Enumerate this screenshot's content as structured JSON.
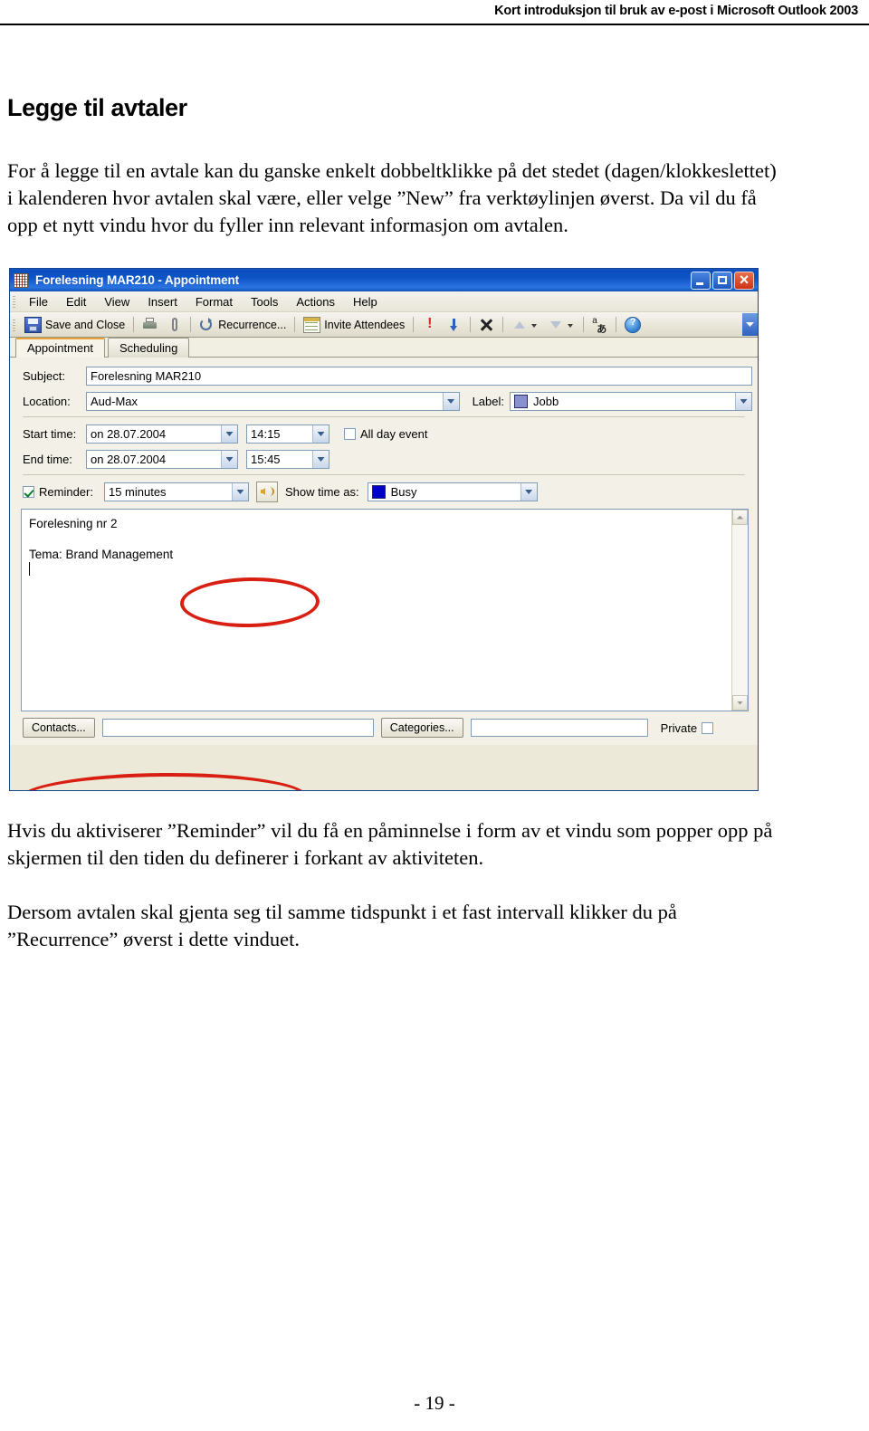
{
  "page": {
    "running_header": "Kort introduksjon til bruk av e-post i Microsoft Outlook 2003",
    "footer": "- 19 -",
    "heading": "Legge til avtaler",
    "paragraph_intro": "For å legge til en avtale kan du ganske enkelt dobbeltklikke på det stedet (dagen/klokkeslettet) i kalenderen hvor avtalen skal være, eller velge ”New” fra verktøylinjen øverst. Da vil du få opp et nytt vindu hvor du fyller inn relevant informasjon om avtalen.",
    "paragraph_reminder": "Hvis du aktiviserer ”Reminder” vil du få en påminnelse i form av et vindu som popper opp på skjermen til den tiden du definerer i forkant av aktiviteten.",
    "paragraph_recurrence": "Dersom avtalen skal gjenta seg til samme tidspunkt i et fast intervall klikker du på ”Recurrence” øverst i dette vinduet."
  },
  "outlook": {
    "titlebar": {
      "title": "Forelesning MAR210 - Appointment",
      "app_icon": "calendar-icon",
      "minimize": "minimize-icon",
      "maximize": "maximize-icon",
      "close": "close-icon"
    },
    "menu": [
      {
        "label": "File"
      },
      {
        "label": "Edit"
      },
      {
        "label": "View"
      },
      {
        "label": "Insert"
      },
      {
        "label": "Format"
      },
      {
        "label": "Tools"
      },
      {
        "label": "Actions"
      },
      {
        "label": "Help"
      }
    ],
    "toolbar": {
      "save_and_close": "Save and Close",
      "recurrence": "Recurrence...",
      "invite_attendees": "Invite Attendees",
      "lang_a": "a",
      "lang_jp": "あ",
      "icons": [
        "save-icon",
        "print-icon",
        "attach-icon",
        "recurrence-icon",
        "invite-attendees-icon",
        "importance-high-icon",
        "importance-low-icon",
        "delete-icon",
        "previous-item-icon",
        "next-item-icon",
        "language-icon",
        "help-icon",
        "toolbar-overflow-icon"
      ]
    },
    "tabs": [
      {
        "label": "Appointment",
        "active": true
      },
      {
        "label": "Scheduling",
        "active": false
      }
    ],
    "form": {
      "subject_label": "Subject:",
      "subject_value": "Forelesning MAR210",
      "location_label": "Location:",
      "location_value": "Aud-Max",
      "label_label": "Label:",
      "label_value": "Jobb",
      "label_color": "#8791cf",
      "start_time_label": "Start time:",
      "start_date_value": "on 28.07.2004",
      "start_clock_value": "14:15",
      "end_time_label": "End time:",
      "end_date_value": "on 28.07.2004",
      "end_clock_value": "15:45",
      "all_day_label": "All day event",
      "all_day_checked": false,
      "reminder_label": "Reminder:",
      "reminder_checked": true,
      "reminder_value": "15 minutes",
      "show_time_as_label": "Show time as:",
      "show_time_as_value": "Busy",
      "show_time_as_color": "#0000c8"
    },
    "notes": {
      "line1": "Forelesning nr 2",
      "line2": "Tema: Brand Management"
    },
    "bottom": {
      "contacts_button": "Contacts...",
      "contacts_value": "",
      "categories_button": "Categories...",
      "categories_value": "",
      "private_label": "Private",
      "private_checked": false
    }
  }
}
